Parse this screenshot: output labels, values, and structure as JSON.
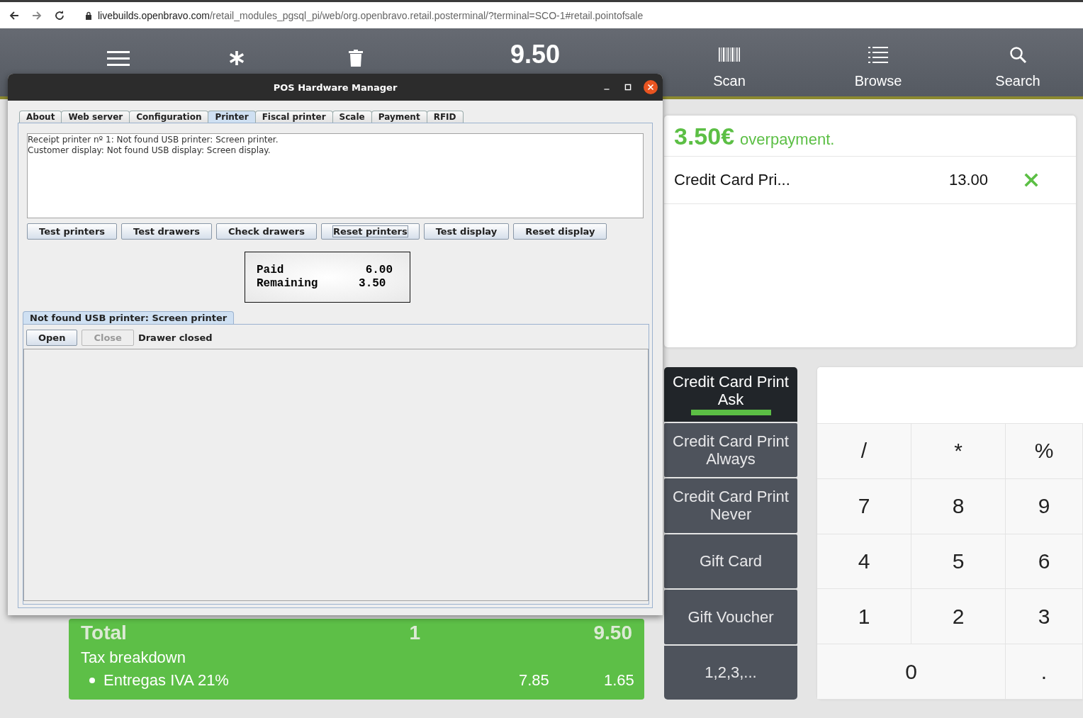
{
  "browser": {
    "url_host": "livebuilds.openbravo.com",
    "url_path": "/retail_modules_pgsql_pi/web/org.openbravo.retail.posterminal/?terminal=SCO-1#retail.pointofsale"
  },
  "toolbar": [
    {
      "kind": "menu"
    },
    {
      "kind": "asterisk"
    },
    {
      "kind": "trash"
    },
    {
      "kind": "total",
      "label": "9.50"
    },
    {
      "kind": "scan",
      "label": "Scan"
    },
    {
      "kind": "browse",
      "label": "Browse"
    },
    {
      "kind": "search",
      "label": "Search"
    }
  ],
  "receipt_totals": {
    "total_label": "Total",
    "total_units": "1",
    "total_amount": "9.50",
    "tax_title": "Tax breakdown",
    "taxes": [
      {
        "name": "Entregas IVA 21%",
        "base": "7.85",
        "amount": "1.65"
      }
    ]
  },
  "payment_panel": {
    "overpayment_amount": "3.50€",
    "overpayment_text": "overpayment.",
    "payments": [
      {
        "name": "Credit Card Pri...",
        "amount": "13.00"
      }
    ]
  },
  "payment_methods": [
    {
      "label": "Credit Card Print Ask",
      "selected": true
    },
    {
      "label": "Credit Card Print Always",
      "selected": false
    },
    {
      "label": "Credit Card Print Never",
      "selected": false
    },
    {
      "label": "Gift Card",
      "selected": false
    },
    {
      "label": "Gift Voucher",
      "selected": false
    },
    {
      "label": "1,2,3,...",
      "selected": false
    }
  ],
  "keypad": [
    {
      "label": "/",
      "wide": false
    },
    {
      "label": "*",
      "wide": false
    },
    {
      "label": "%",
      "wide": false
    },
    {
      "label": "7",
      "wide": false
    },
    {
      "label": "8",
      "wide": false
    },
    {
      "label": "9",
      "wide": false
    },
    {
      "label": "4",
      "wide": false
    },
    {
      "label": "5",
      "wide": false
    },
    {
      "label": "6",
      "wide": false
    },
    {
      "label": "1",
      "wide": false
    },
    {
      "label": "2",
      "wide": false
    },
    {
      "label": "3",
      "wide": false
    },
    {
      "label": "0",
      "wide": true
    },
    {
      "label": ".",
      "wide": false
    }
  ],
  "dialog": {
    "title": "POS Hardware Manager",
    "tabs": [
      {
        "label": "About",
        "selected": false
      },
      {
        "label": "Web server",
        "selected": false
      },
      {
        "label": "Configuration",
        "selected": false
      },
      {
        "label": "Printer",
        "selected": true
      },
      {
        "label": "Fiscal printer",
        "selected": false
      },
      {
        "label": "Scale",
        "selected": false
      },
      {
        "label": "Payment",
        "selected": false
      },
      {
        "label": "RFID",
        "selected": false
      }
    ],
    "log_lines": [
      "Receipt printer nº 1: Not found USB printer: Screen printer.",
      "Customer display: Not found USB display: Screen display."
    ],
    "buttons": [
      {
        "label": "Test printers",
        "focused": false
      },
      {
        "label": "Test drawers",
        "focused": false
      },
      {
        "label": "Check drawers",
        "focused": false
      },
      {
        "label": "Reset printers",
        "focused": true
      },
      {
        "label": "Test display",
        "focused": false
      },
      {
        "label": "Reset display",
        "focused": false
      }
    ],
    "display_lines": [
      "Paid            6.00",
      "Remaining      3.50"
    ],
    "printer_tab": "Not found USB printer: Screen printer",
    "drawer_buttons": [
      {
        "label": "Open",
        "disabled": false
      },
      {
        "label": "Close",
        "disabled": true
      }
    ],
    "drawer_status": "Drawer closed"
  }
}
